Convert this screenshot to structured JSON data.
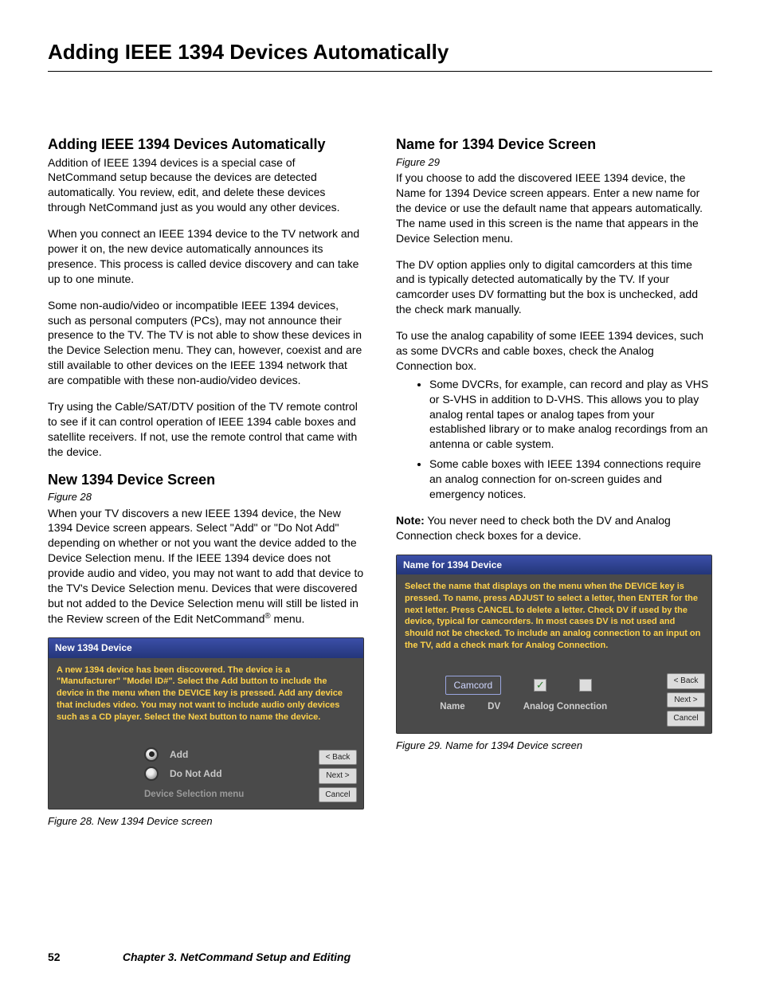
{
  "page": {
    "title": "Adding IEEE 1394 Devices Automatically",
    "number": "52",
    "chapter": "Chapter 3. NetCommand Setup and Editing"
  },
  "left": {
    "h1": "Adding IEEE 1394 Devices Automatically",
    "p1": "Addition of IEEE 1394 devices is a special case of NetCommand setup because the devices are detected automatically.  You review, edit, and delete these devices through NetCommand just as you would any other devices.",
    "p2": "When you connect an IEEE 1394 device to the TV network and power it on, the new device automatically announces its presence.  This process is called device discovery and can take up to one minute.",
    "p3": "Some non-audio/video or incompatible IEEE 1394 devices, such as personal computers (PCs), may not announce their presence to the TV.  The TV is not able to show these devices in the Device Selection menu.  They can, however, coexist and are still available to other devices on the IEEE 1394 network that are compatible with these non-audio/video devices.",
    "p4": "Try using the Cable/SAT/DTV position of the TV remote control to see if it can control operation of IEEE 1394 cable boxes and satellite receivers.  If not, use the remote control that came with the device.",
    "h2": "New 1394 Device Screen",
    "figref2": "Figure 28",
    "p5a": "When your TV discovers a new IEEE 1394 device, the New 1394 Device screen appears.  Select \"Add\" or \"Do Not Add\" depending on whether or not you want the device added to the Device Selection menu.  If the IEEE 1394 device does not provide audio and video, you may not want to add that device to the TV's Device Selection menu.  Devices that were discovered but not added to the Device Selection menu will still be listed in the Review screen of the Edit NetCommand",
    "p5b": " menu.",
    "reg": "®",
    "fig28": {
      "title": "New 1394 Device",
      "instr": "A new 1394 device has been discovered. The device is a \"Manufacturer\" \"Model ID#\".  Select the Add button to include the device in the menu when the DEVICE key is pressed.   Add any device that includes video.  You may not want to include audio only devices such as a CD player.  Select the Next button to name the device.",
      "opt_add": "Add",
      "opt_noadd": "Do Not Add",
      "dsm": "Device Selection menu",
      "back": "< Back",
      "next": "Next >",
      "cancel": "Cancel",
      "caption": "Figure 28. New 1394 Device screen"
    }
  },
  "right": {
    "h1": "Name for 1394 Device Screen",
    "figref": "Figure 29",
    "p1": "If you choose to add the discovered IEEE 1394 device, the Name for 1394 Device screen appears.  Enter a new name for the device or use the default name that appears automatically.  The name used in this screen is the name that appears in the Device Selection menu.",
    "p2": "The DV option applies only to digital camcorders at this time and is typically detected automatically by the TV.  If your camcorder uses DV formatting but the box is unchecked, add the check mark manually.",
    "p3": "To use the analog capability of some IEEE 1394 devices, such as some DVCRs and cable boxes, check the Analog Connection box.",
    "b1": "Some DVCRs, for example, can record and play as VHS or S-VHS in addition to D-VHS.  This allows you to play analog rental tapes or analog tapes from your established library or to make analog recordings from an antenna or cable system.",
    "b2": "Some cable boxes with IEEE 1394 connections require an analog connection for on-screen guides and emergency notices.",
    "note_label": "Note:",
    "note": "  You never need to check both the DV and Analog Connection check boxes for a device.",
    "fig29": {
      "title": "Name for 1394 Device",
      "instr": "Select the name that displays on the menu when the DEVICE key is pressed.  To name, press ADJUST to select a letter, then ENTER for the next letter. Press CANCEL to delete a letter. Check DV if used by the device, typical for camcorders.  In most cases DV is not used and should not be checked.  To include an analog connection to an input on the TV, add a check mark for Analog Connection.",
      "name_value": "Camcord",
      "label_name": "Name",
      "label_dv": "DV",
      "label_analog": "Analog Connection",
      "back": "< Back",
      "next": "Next >",
      "cancel": "Cancel",
      "caption": "Figure 29. Name for 1394 Device screen"
    }
  }
}
